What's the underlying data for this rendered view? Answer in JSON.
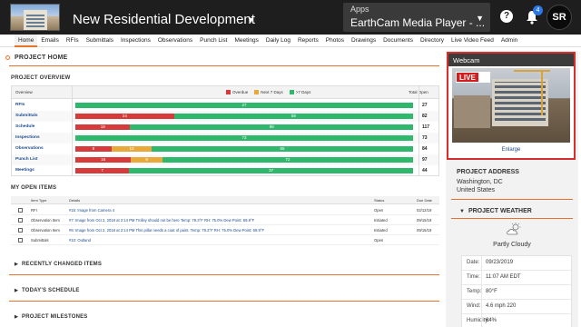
{
  "header": {
    "project_title": "New Residential Development",
    "apps_label": "Apps",
    "apps_value": "EarthCam Media Player - ...",
    "notification_count": "4",
    "avatar_initials": "SR",
    "help_label": "?"
  },
  "nav": {
    "items": [
      "Home",
      "Emails",
      "RFIs",
      "Submittals",
      "Inspections",
      "Observations",
      "Punch List",
      "Meetings",
      "Daily Log",
      "Reports",
      "Photos",
      "Drawings",
      "Documents",
      "Directory",
      "Live Video Feed",
      "Admin"
    ],
    "active": "Home"
  },
  "page_title": "PROJECT HOME",
  "overview": {
    "section_title": "PROJECT OVERVIEW",
    "col_overview": "Overview",
    "col_total": "Total Open",
    "legend": [
      {
        "label": "Overdue",
        "color": "#d63a3a"
      },
      {
        "label": "Next 7 Days",
        "color": "#e8a93a"
      },
      {
        "label": ">7 Days",
        "color": "#2eb86e"
      }
    ],
    "rows": [
      {
        "label": "RFIs",
        "overdue": 0,
        "next7": 0,
        "later": 27,
        "total": "27"
      },
      {
        "label": "Submittals",
        "overdue": 24,
        "next7": 0,
        "later": 58,
        "total": "82"
      },
      {
        "label": "Schedule",
        "overdue": 19,
        "next7": 0,
        "later": 98,
        "total": "117"
      },
      {
        "label": "Inspections",
        "overdue": 0,
        "next7": 0,
        "later": 73,
        "total": "73"
      },
      {
        "label": "Observations",
        "overdue": 9,
        "next7": 10,
        "later": 65,
        "total": "84"
      },
      {
        "label": "Punch List",
        "overdue": 16,
        "next7": 9,
        "later": 72,
        "total": "97"
      },
      {
        "label": "Meetings",
        "overdue": 7,
        "next7": 0,
        "later": 37,
        "total": "44"
      }
    ]
  },
  "open_items": {
    "section_title": "MY OPEN ITEMS",
    "headers": {
      "type": "Item Type",
      "details": "Details",
      "status": "Status",
      "due": "Due Date"
    },
    "rows": [
      {
        "type": "RFI",
        "details": "#15: Image from Camera 4",
        "status": "Open",
        "due": "02/12/19"
      },
      {
        "type": "Observation Item",
        "details": "#7: Image from Oct 2, 2018 at 2:14 PM Trolley should not be here Temp: 79.3°F RH: 75.0% Dew Point: 69.9°F",
        "status": "Initiated",
        "due": "09/15/19"
      },
      {
        "type": "Observation Item",
        "details": "#6: Image from Oct 2, 2018 at 2:14 PM This pillar needs a coat of paint. Temp: 79.3°F RH: 75.0% Dew Point: 69.9°F",
        "status": "Initiated",
        "due": "09/15/19"
      },
      {
        "type": "Submittals",
        "details": "#10: Outland",
        "status": "Open",
        "due": ""
      }
    ]
  },
  "collapsed_sections": [
    "RECENTLY CHANGED ITEMS",
    "TODAY'S SCHEDULE",
    "PROJECT MILESTONES"
  ],
  "webcam": {
    "title": "Webcam",
    "live_label": "LIVE",
    "enlarge_label": "Enlarge"
  },
  "address": {
    "title": "PROJECT ADDRESS",
    "line1": "Washington, DC",
    "line2": "United States"
  },
  "weather": {
    "title": "PROJECT WEATHER",
    "condition": "Partly Cloudy",
    "rows": [
      {
        "key": "Date:",
        "value": "09/23/2019"
      },
      {
        "key": "Time:",
        "value": "11:07 AM EDT"
      },
      {
        "key": "Temp:",
        "value": "80°F"
      },
      {
        "key": "Wind:",
        "value": "4.6 mph 220"
      },
      {
        "key": "Humidity:",
        "value": "64%"
      }
    ]
  }
}
